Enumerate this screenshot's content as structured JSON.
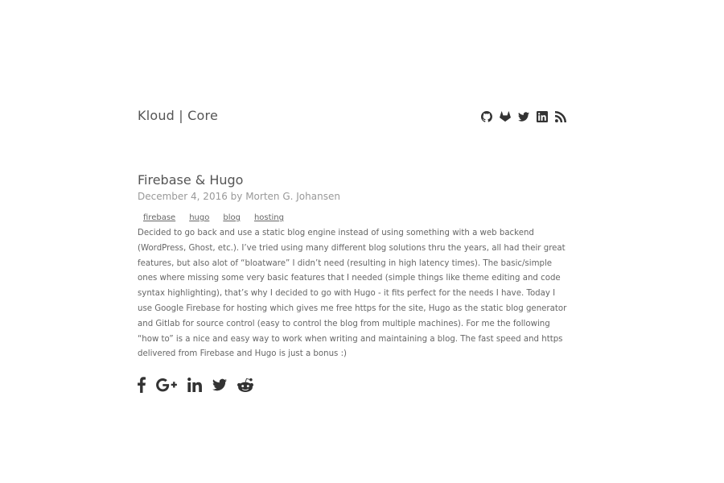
{
  "header": {
    "site_title": "Kloud | Core",
    "social_icons": [
      "github-icon",
      "gitlab-icon",
      "twitter-icon",
      "linkedin-icon",
      "rss-icon"
    ]
  },
  "post": {
    "title": "Firebase & Hugo",
    "meta": "December 4, 2016 by Morten G. Johansen",
    "tags": [
      "firebase",
      "hugo",
      "blog",
      "hosting"
    ],
    "body": "Decided to go back and use a static blog engine instead of using something with a web backend (WordPress, Ghost, etc.). I’ve tried using many different blog solutions thru the years, all had their great features, but also alot of “bloatware” I didn’t need (resulting in high latency times). The basic/simple ones where missing some very basic features that I needed (simple things like theme editing and code syntax highlighting), that’s why I decided to go with Hugo - it fits perfect for the needs I have. Today I use Google Firebase for hosting which gives me free https for the site, Hugo as the static blog generator and Gitlab for source control (easy to control the blog from multiple machines). For me the following “how to” is a nice and easy way to work when writing and maintaining a blog. The fast speed and https delivered from Firebase and Hugo is just a bonus :)"
  },
  "share": {
    "icons": [
      "facebook-icon",
      "google-plus-icon",
      "linkedin-icon",
      "twitter-icon",
      "reddit-icon"
    ]
  },
  "colors": {
    "text": "#555555",
    "meta": "#999999",
    "icon": "#333333",
    "background": "#ffffff"
  }
}
